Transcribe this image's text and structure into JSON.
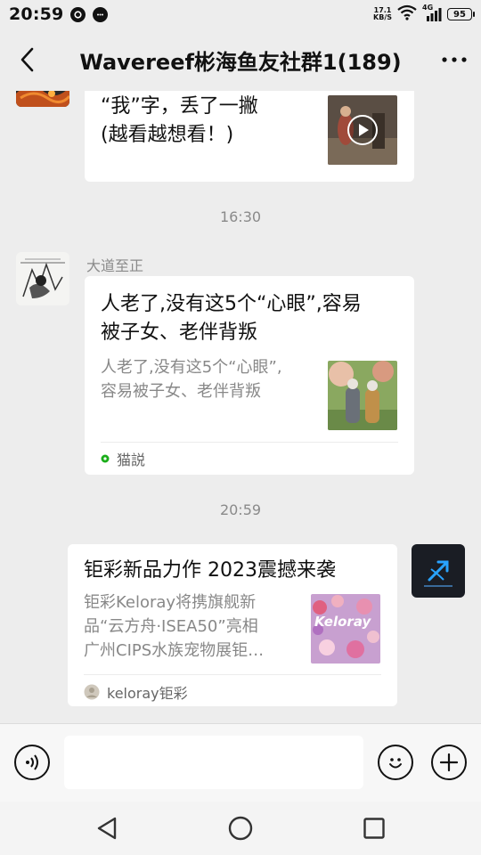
{
  "status_bar": {
    "time": "20:59",
    "net_speed_value": "17.1",
    "net_speed_unit": "KB/S",
    "network_type": "4G",
    "battery": "95"
  },
  "header": {
    "title": "Wavereef彬海鱼友社群1(189)"
  },
  "messages": [
    {
      "kind": "link_card_partial",
      "title_line1": "“我”字，丢了一撇",
      "title_line2": "(越看越想看！)"
    },
    {
      "kind": "timestamp",
      "text": "16:30"
    },
    {
      "kind": "link_card",
      "sender": "大道至正",
      "title_line1": "人老了,没有这5个“心眼”,容易",
      "title_line2": "被子女、老伴背叛",
      "desc_line1": "人老了,没有这5个“心眼”,",
      "desc_line2": "容易被子女、老伴背叛",
      "source": "猫説"
    },
    {
      "kind": "timestamp",
      "text": "20:59"
    },
    {
      "kind": "link_card_self",
      "title": "钜彩新品力作 2023震撼来袭",
      "desc_line1": "钜彩Keloray将携旗舰新",
      "desc_line2": "品“云方舟·ISEA50”亮相",
      "desc_line3": "广州CIPS水族宠物展钜…",
      "source": "keloray钜彩",
      "thumb_logo": "Keloray"
    }
  ],
  "colors": {
    "background": "#ededed",
    "card": "#ffffff",
    "meta_text": "#8a8a8a",
    "source_dot": "#1aad19"
  }
}
